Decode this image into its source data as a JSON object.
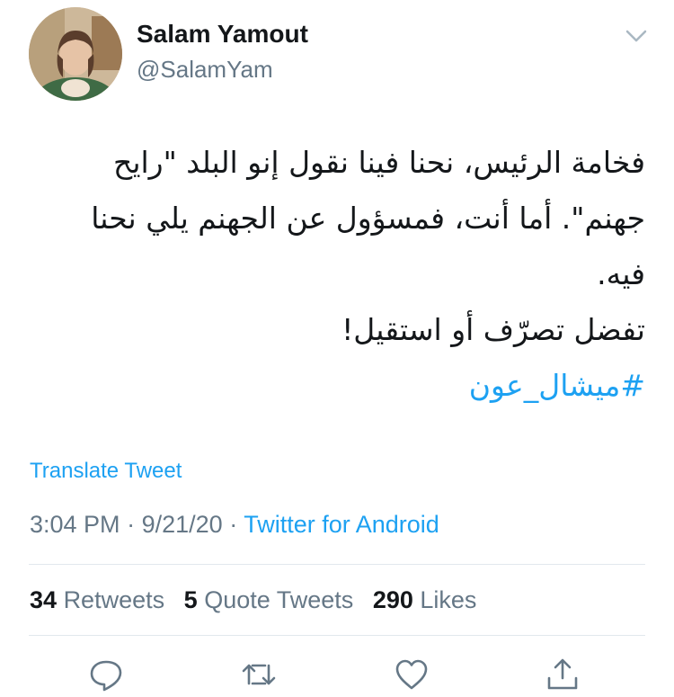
{
  "author": {
    "name": "Salam Yamout",
    "handle": "@SalamYam"
  },
  "tweet": {
    "lines": [
      "فخامة الرئيس، نحنا فينا نقول إنو البلد \"رايح",
      "جهنم\". أما أنت، فمسؤول عن الجهنم يلي نحنا",
      "فيه.",
      "تفضل تصرّف أو استقيل!"
    ],
    "hashtag": "#ميشال_عون"
  },
  "translate_label": "Translate Tweet",
  "meta": {
    "time": "3:04 PM",
    "separator": "·",
    "date": "9/21/20",
    "source": "Twitter for Android"
  },
  "stats": {
    "retweets_count": "34",
    "retweets_label": "Retweets",
    "quotes_count": "5",
    "quotes_label": "Quote Tweets",
    "likes_count": "290",
    "likes_label": "Likes"
  },
  "actions": [
    "reply-icon",
    "retweet-icon",
    "like-icon",
    "share-icon"
  ],
  "colors": {
    "link": "#1da1f2",
    "text": "#14171a",
    "secondary": "#657786",
    "divider": "#e1e8ed"
  }
}
